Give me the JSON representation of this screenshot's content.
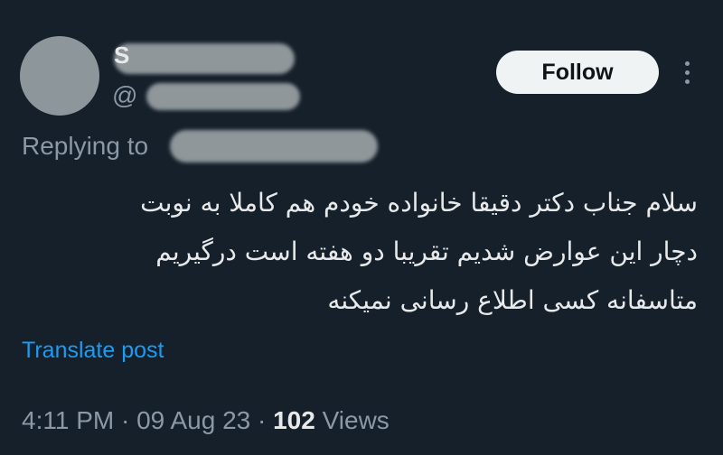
{
  "author": {
    "name_visible": "S",
    "handle_prefix": "@"
  },
  "actions": {
    "follow_label": "Follow",
    "more_icon": "more-vertical-icon"
  },
  "reply": {
    "label": "Replying to"
  },
  "tweet": {
    "lines": [
      "سلام جناب دکتر دقیقا خانواده خودم هم کاملا به نوبت",
      "دچار این عوارض شدیم تقریبا دو هفته است درگیریم",
      "متاسفانه کسی اطلاع رسانی نمیکنه"
    ]
  },
  "translate_label": "Translate post",
  "meta": {
    "time": "4:11 PM",
    "date": "09 Aug 23",
    "views_count": "102",
    "views_label": "Views",
    "separator": "·"
  },
  "colors": {
    "background": "#15202b",
    "link": "#1d9bf0",
    "muted": "#8b98a5"
  }
}
